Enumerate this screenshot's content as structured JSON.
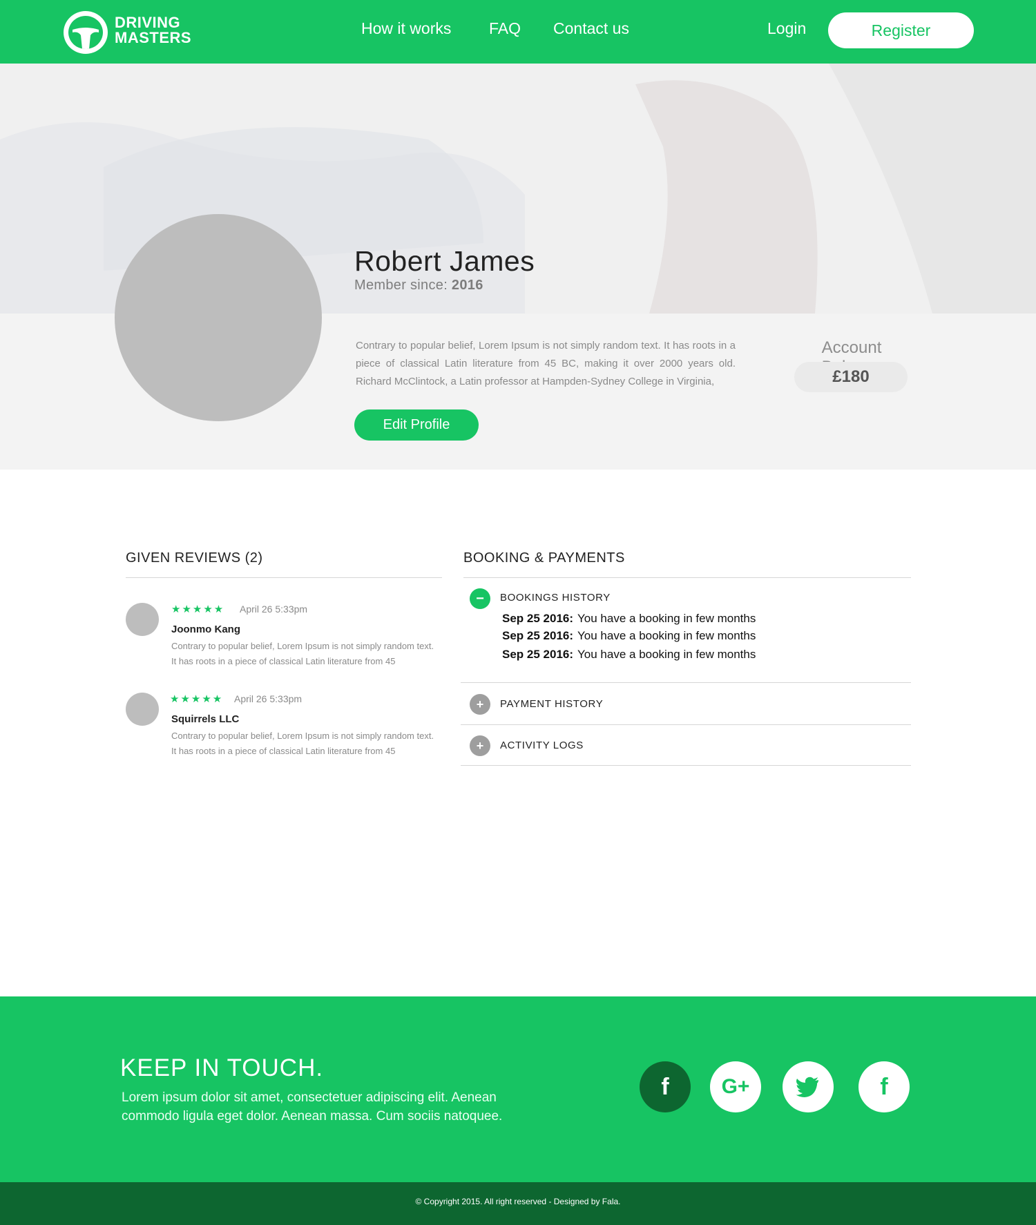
{
  "brand": {
    "line1": "DRIVING",
    "line2": "MASTERS"
  },
  "nav": {
    "how_it_works": "How it works",
    "faq": "FAQ",
    "contact": "Contact us",
    "login": "Login",
    "register": "Register"
  },
  "profile": {
    "name": "Robert James",
    "member_since_label": "Member since: ",
    "member_since_year": "2016",
    "bio": "Contrary to popular belief, Lorem Ipsum is not simply random text. It has roots in a piece of classical Latin literature from 45 BC, making it over 2000 years old. Richard McClintock, a Latin professor at Hampden-Sydney College in Virginia,",
    "edit_button": "Edit Profile",
    "balance_label": "Account Balance",
    "balance_value": "£180"
  },
  "reviews": {
    "title": "GIVEN REVIEWS (2)",
    "items": [
      {
        "stars": "★★★★★",
        "rating": 5,
        "date": "April 26 5:33pm",
        "author": "Joonmo Kang",
        "text": "Contrary to popular belief, Lorem Ipsum is not simply random text. It has roots in a piece of classical Latin literature from 45"
      },
      {
        "stars": "★★★★★",
        "rating": 5,
        "date": "April 26 5:33pm",
        "author": "Squirrels LLC",
        "text": "Contrary to popular belief, Lorem Ipsum is not simply random text. It has roots in a piece of classical Latin literature from 45"
      }
    ]
  },
  "bookings": {
    "title": "BOOKING & PAYMENTS",
    "sections": [
      {
        "label": "BOOKINGS HISTORY",
        "icon": "−",
        "expanded": true
      },
      {
        "label": "PAYMENT HISTORY",
        "icon": "+",
        "expanded": false
      },
      {
        "label": "ACTIVITY LOGS",
        "icon": "+",
        "expanded": false
      }
    ],
    "history": [
      {
        "date": "Sep 25 2016:",
        "text": "You have a booking in few months"
      },
      {
        "date": "Sep 25 2016:",
        "text": "You have a booking in few months"
      },
      {
        "date": "Sep 25 2016:",
        "text": "You have a booking in few months"
      }
    ]
  },
  "footer": {
    "title": "KEEP IN TOUCH.",
    "text": "Lorem ipsum dolor sit amet, consectetuer adipiscing elit. Aenean commodo ligula eget dolor. Aenean massa. Cum sociis natoquee.",
    "social": [
      {
        "icon": "facebook-icon",
        "glyph": "f"
      },
      {
        "icon": "google-plus-icon",
        "glyph": "G+"
      },
      {
        "icon": "twitter-icon",
        "glyph": ""
      },
      {
        "icon": "facebook-icon",
        "glyph": "f"
      }
    ],
    "copyright": "© Copyright 2015.  All right reserved  -  Designed by Fala."
  },
  "colors": {
    "brand_green": "#17c463",
    "dark_green": "#0d6630",
    "avatar_gray": "#bdbdbd"
  }
}
